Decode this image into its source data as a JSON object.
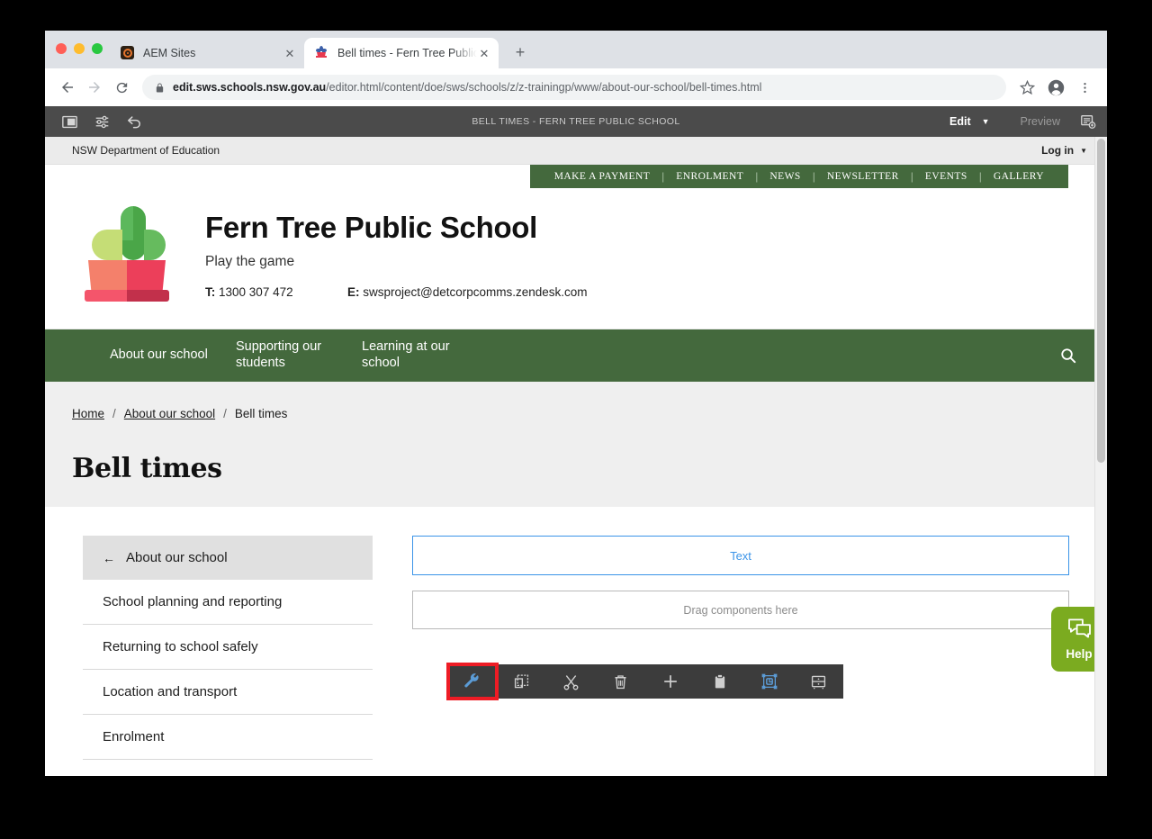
{
  "browser": {
    "tabs": [
      {
        "title": "AEM Sites",
        "favicon": "aem-logo-icon",
        "active": false,
        "close_label": "✕"
      },
      {
        "title": "Bell times - Fern Tree Public Sc",
        "favicon": "school-plant-icon",
        "active": true,
        "close_label": "✕"
      }
    ],
    "new_tab_label": "+",
    "nav": {
      "back_label": "←",
      "forward_label": "→",
      "reload_label": "↻"
    },
    "url": {
      "lock_icon": "padlock-icon",
      "host": "edit.sws.schools.nsw.gov.au",
      "path": "/editor.html/content/doe/sws/schools/z/z-trainingp/www/about-our-school/bell-times.html"
    },
    "toolbar_right": {
      "bookmark_icon": "star-icon",
      "profile_icon": "account-avatar-icon",
      "menu_icon": "three-dot-menu-icon"
    }
  },
  "aem_bar": {
    "left_icons": [
      "side-panel-toggle-icon",
      "page-controls-icon",
      "undo-icon"
    ],
    "page_title": "BELL TIMES - FERN TREE PUBLIC SCHOOL",
    "edit_label": "Edit",
    "edit_caret": "▼",
    "preview_label": "Preview",
    "annotate_icon": "page-information-icon"
  },
  "component_toolbar": {
    "buttons": [
      {
        "name": "configure-button",
        "icon": "wrench-icon",
        "highlighted": true
      },
      {
        "name": "copy-button",
        "icon": "copy-icon",
        "highlighted": false
      },
      {
        "name": "cut-button",
        "icon": "scissors-icon",
        "highlighted": false
      },
      {
        "name": "delete-button",
        "icon": "trash-icon",
        "highlighted": false
      },
      {
        "name": "insert-button",
        "icon": "plus-icon",
        "highlighted": false
      },
      {
        "name": "paste-button",
        "icon": "clipboard-icon",
        "highlighted": false
      },
      {
        "name": "select-parent-button",
        "icon": "group-select-icon",
        "highlighted": false
      },
      {
        "name": "layout-button",
        "icon": "layout-container-icon",
        "highlighted": false
      }
    ]
  },
  "page": {
    "department_bar": {
      "name": "NSW Department of Education",
      "login_label": "Log in",
      "login_caret": "▼"
    },
    "utility_nav": [
      "MAKE A PAYMENT",
      "ENROLMENT",
      "NEWS",
      "NEWSLETTER",
      "EVENTS",
      "GALLERY"
    ],
    "utility_separator": "|",
    "school": {
      "logo_icon": "plant-in-pot-logo",
      "name": "Fern Tree Public School",
      "motto": "Play the game",
      "phone_label": "T:",
      "phone": "1300 307 472",
      "email_label": "E:",
      "email": "swsproject@detcorpcomms.zendesk.com"
    },
    "main_nav": [
      "About our school",
      "Supporting our students",
      "Learning at our school"
    ],
    "search_icon": "search-icon",
    "breadcrumb": [
      {
        "label": "Home",
        "link": true
      },
      {
        "label": "About our school",
        "link": true
      },
      {
        "label": "Bell times",
        "link": false
      }
    ],
    "breadcrumb_separator": "/",
    "title": "Bell times",
    "side_nav": {
      "parent": {
        "label": "About our school",
        "arrow": "←"
      },
      "items": [
        "School planning and reporting",
        "Returning to school safely",
        "Location and transport",
        "Enrolment"
      ]
    },
    "components": {
      "text_component_label": "Text",
      "dropzone_label": "Drag components here"
    },
    "help_widget": {
      "label": "Help",
      "icon": "chat-bubbles-icon"
    }
  },
  "colors": {
    "school_green": "#44693d",
    "help_green": "#7bab20",
    "aem_blue": "#3b94e8",
    "highlight_red": "#ee1c25",
    "aem_toolbar_dark": "#3c3c3c"
  }
}
